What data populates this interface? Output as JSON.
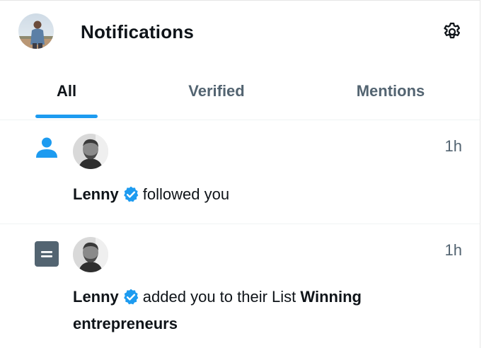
{
  "header": {
    "title": "Notifications",
    "avatar_icon": "profile-avatar",
    "settings_icon": "gear-icon"
  },
  "tabs": [
    {
      "label": "All",
      "active": true
    },
    {
      "label": "Verified",
      "active": false
    },
    {
      "label": "Mentions",
      "active": false
    }
  ],
  "notifications": [
    {
      "type_icon": "person-icon",
      "name": "Lenny",
      "verified": true,
      "text": "followed you",
      "time": "1h"
    },
    {
      "type_icon": "list-icon",
      "name": "Lenny",
      "verified": true,
      "text": "added you to their List",
      "list_name": "Winning entrepreneurs",
      "time": "1h"
    }
  ],
  "colors": {
    "accent": "#1d9bf0",
    "text_primary": "#0f1419",
    "text_secondary": "#536471",
    "divider": "#eff3f4",
    "list_icon_bg": "#536471"
  }
}
